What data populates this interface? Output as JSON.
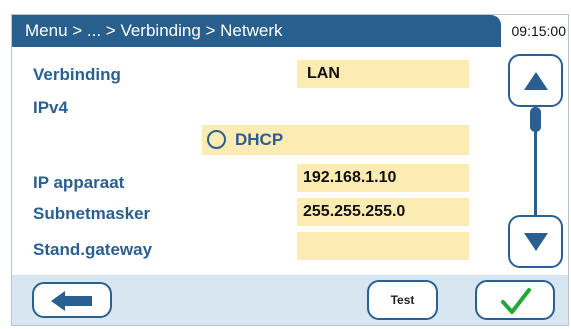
{
  "header": {
    "breadcrumb": "Menu > ... > Verbinding > Netwerk",
    "time": "09:15:00"
  },
  "form": {
    "verbinding_label": "Verbinding",
    "verbinding_value": "LAN",
    "ipv4_label": "IPv4",
    "dhcp_label": "DHCP",
    "dhcp_checked": false,
    "ip_label": "IP apparaat",
    "ip_value": "192.168.1.10",
    "subnet_label": "Subnetmasker",
    "subnet_value": "255.255.255.0",
    "gateway_label": "Stand.gateway",
    "gateway_value": ""
  },
  "footer": {
    "test_label": "Test"
  },
  "colors": {
    "header_bg": "#295f8d",
    "accent": "#2a5f92",
    "field_bg": "#fcebb2",
    "footer_bg": "#d7e6f1",
    "confirm_green": "#22a838"
  },
  "icons": {
    "scroll_up": "triangle-up-icon",
    "scroll_down": "triangle-down-icon",
    "back": "arrow-left-icon",
    "confirm": "checkmark-icon"
  }
}
